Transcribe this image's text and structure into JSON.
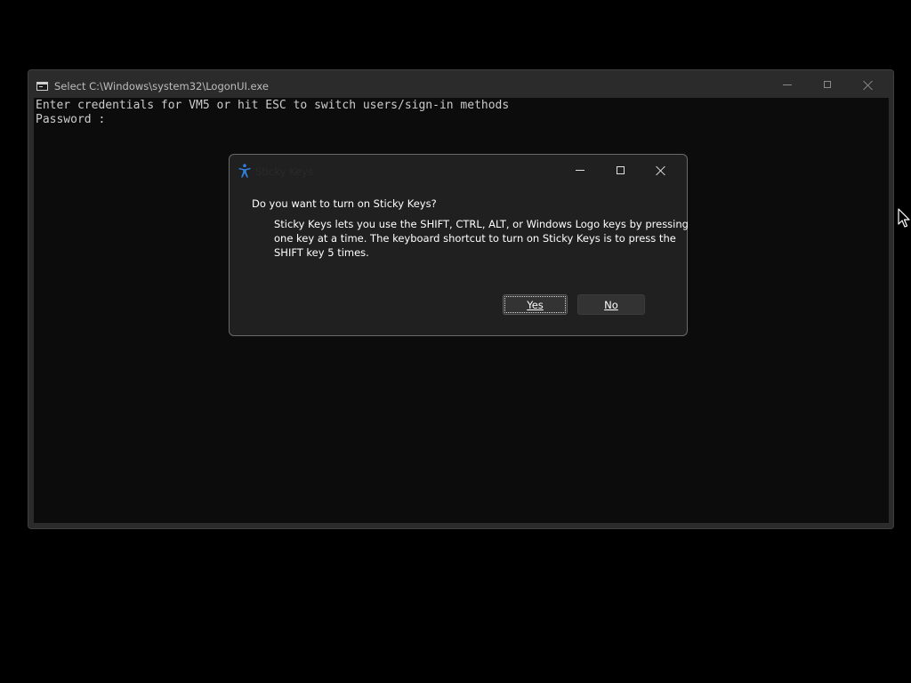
{
  "console": {
    "title": "Select C:\\Windows\\system32\\LogonUI.exe",
    "lines": [
      "Enter credentials for VM5 or hit ESC to switch users/sign-in methods",
      "Password :"
    ],
    "icon": "console-app-icon",
    "window_controls": [
      "minimize-icon",
      "maximize-icon",
      "close-icon"
    ]
  },
  "dialog": {
    "title": "Sticky Keys",
    "icon": "accessibility-icon",
    "question": "Do you want to turn on Sticky Keys?",
    "message_lines": [
      "Sticky Keys lets you use the SHIFT, CTRL, ALT, or Windows Logo keys by pressing",
      "one key at a time. The keyboard shortcut to turn on Sticky Keys is to press the",
      "SHIFT key 5 times."
    ],
    "yes_label": "Yes",
    "no_label": "No",
    "window_controls": [
      "minimize-icon",
      "maximize-icon",
      "close-icon"
    ]
  },
  "colors": {
    "desktop_background": "#000000",
    "console_background": "#0c0c0c",
    "dialog_background": "#202020",
    "accent_icon": "#2f7ed8"
  },
  "pointer": "mouse-cursor-icon"
}
